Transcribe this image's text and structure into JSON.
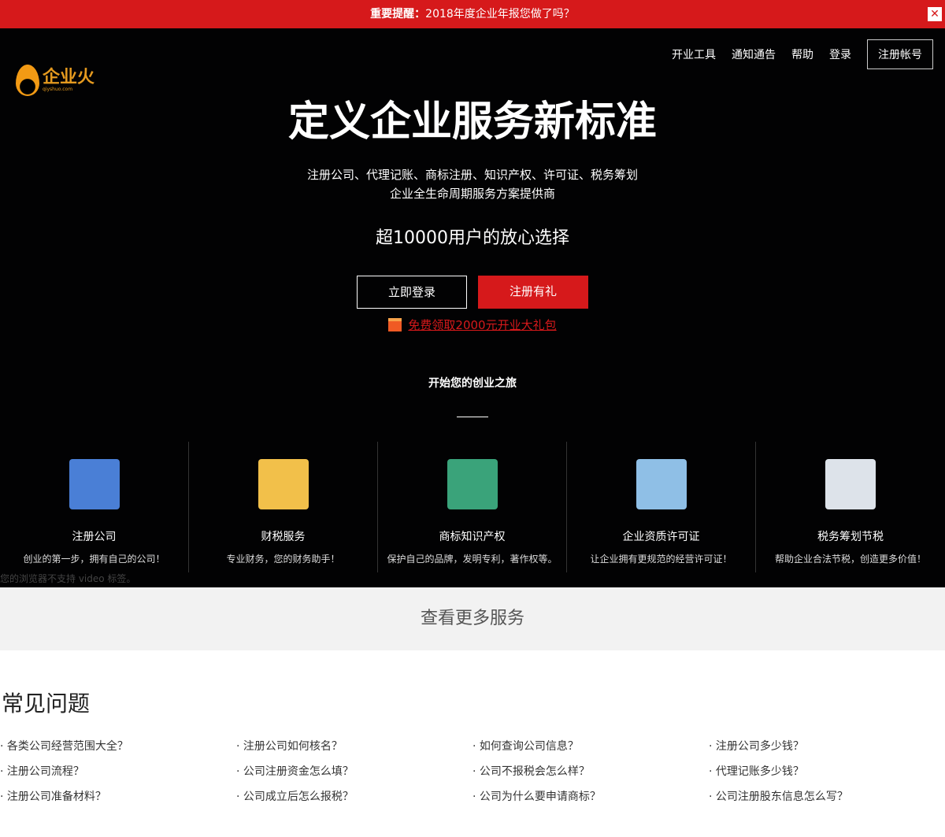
{
  "notice": {
    "strong": "重要提醒：",
    "text": "2018年度企业年报您做了吗？",
    "close": "✕"
  },
  "logo": {
    "name": "企业火",
    "domain": "qiyshuo.com"
  },
  "nav": [
    "开业工具",
    "通知通告",
    "帮助",
    "登录"
  ],
  "nav_register": "注册帐号",
  "hero": {
    "title": "定义企业服务新标准",
    "sub1": "注册公司、代理记账、商标注册、知识产权、许可证、税务筹划",
    "sub2": "企业全生命周期服务方案提供商",
    "users": "超10000用户的放心选择",
    "login": "立即登录",
    "signup": "注册有礼",
    "gift": "免费领取2000元开业大礼包",
    "journey": "开始您的创业之旅"
  },
  "services": [
    {
      "title": "注册公司",
      "desc": "创业的第一步，拥有自己的公司！",
      "color": "#4a7fd6"
    },
    {
      "title": "财税服务",
      "desc": "专业财务，您的财务助手！",
      "color": "#f2c04a"
    },
    {
      "title": "商标知识产权",
      "desc": "保护自己的品牌，发明专利，著作权等。",
      "color": "#3aa37a"
    },
    {
      "title": "企业资质许可证",
      "desc": "让企业拥有更规范的经营许可证！",
      "color": "#8fbfe6"
    },
    {
      "title": "税务筹划节税",
      "desc": "帮助企业合法节税，创造更多价值！",
      "color": "#dde3ea"
    }
  ],
  "video_fallback": "您的浏览器不支持 video 标签。",
  "more": "查看更多服务",
  "faq": {
    "title": "常见问题",
    "items": [
      "· 各类公司经营范围大全？",
      "· 注册公司如何核名？",
      "· 如何查询公司信息？",
      "· 注册公司多少钱？",
      "· 注册公司流程？",
      "· 公司注册资金怎么填？",
      "· 公司不报税会怎么样？",
      "· 代理记账多少钱？",
      "· 注册公司准备材料？",
      "· 公司成立后怎么报税？",
      "· 公司为什么要申请商标？",
      "· 公司注册股东信息怎么写？"
    ]
  }
}
